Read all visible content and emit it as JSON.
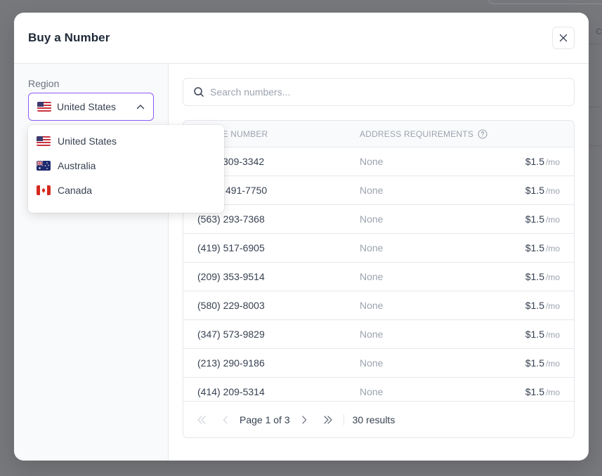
{
  "modal": {
    "title": "Buy a Number",
    "close_icon": "close-icon"
  },
  "region": {
    "label": "Region",
    "selected": "United States",
    "selected_flag": "us",
    "chevron_icon": "chevron-up-icon",
    "options": [
      {
        "label": "United States",
        "flag": "us"
      },
      {
        "label": "Australia",
        "flag": "au"
      },
      {
        "label": "Canada",
        "flag": "ca"
      }
    ]
  },
  "search": {
    "placeholder": "Search numbers...",
    "value": "",
    "icon": "search-icon"
  },
  "table": {
    "columns": {
      "phone": "PHONE NUMBER",
      "address": "ADDRESS REQUIREMENTS",
      "address_help_icon": "help-circle-icon"
    },
    "rows": [
      {
        "phone": "309-3342",
        "phone_partial_visible": true,
        "address": "None",
        "price": "$1.5",
        "period": "/mo"
      },
      {
        "phone": "491-7750",
        "phone_partial_visible": true,
        "address": "None",
        "price": "$1.5",
        "period": "/mo"
      },
      {
        "phone": "(563) 293-7368",
        "address": "None",
        "price": "$1.5",
        "period": "/mo"
      },
      {
        "phone": "(419) 517-6905",
        "address": "None",
        "price": "$1.5",
        "period": "/mo"
      },
      {
        "phone": "(209) 353-9514",
        "address": "None",
        "price": "$1.5",
        "period": "/mo"
      },
      {
        "phone": "(580) 229-8003",
        "address": "None",
        "price": "$1.5",
        "period": "/mo"
      },
      {
        "phone": "(347) 573-9829",
        "address": "None",
        "price": "$1.5",
        "period": "/mo"
      },
      {
        "phone": "(213) 290-9186",
        "address": "None",
        "price": "$1.5",
        "period": "/mo"
      },
      {
        "phone": "(414) 209-5314",
        "address": "None",
        "price": "$1.5",
        "period": "/mo"
      }
    ]
  },
  "pagination": {
    "page_text": "Page 1 of 3",
    "current_page": 1,
    "total_pages": 3,
    "results_text": "30 results",
    "first_icon": "chevrons-left-icon",
    "prev_icon": "chevron-left-icon",
    "next_icon": "chevron-right-icon",
    "last_icon": "chevrons-right-icon"
  },
  "colors": {
    "accent": "#8b5cf6",
    "overlay": "#77787c",
    "muted_text": "#9ca3af",
    "border": "#e5e7eb"
  }
}
